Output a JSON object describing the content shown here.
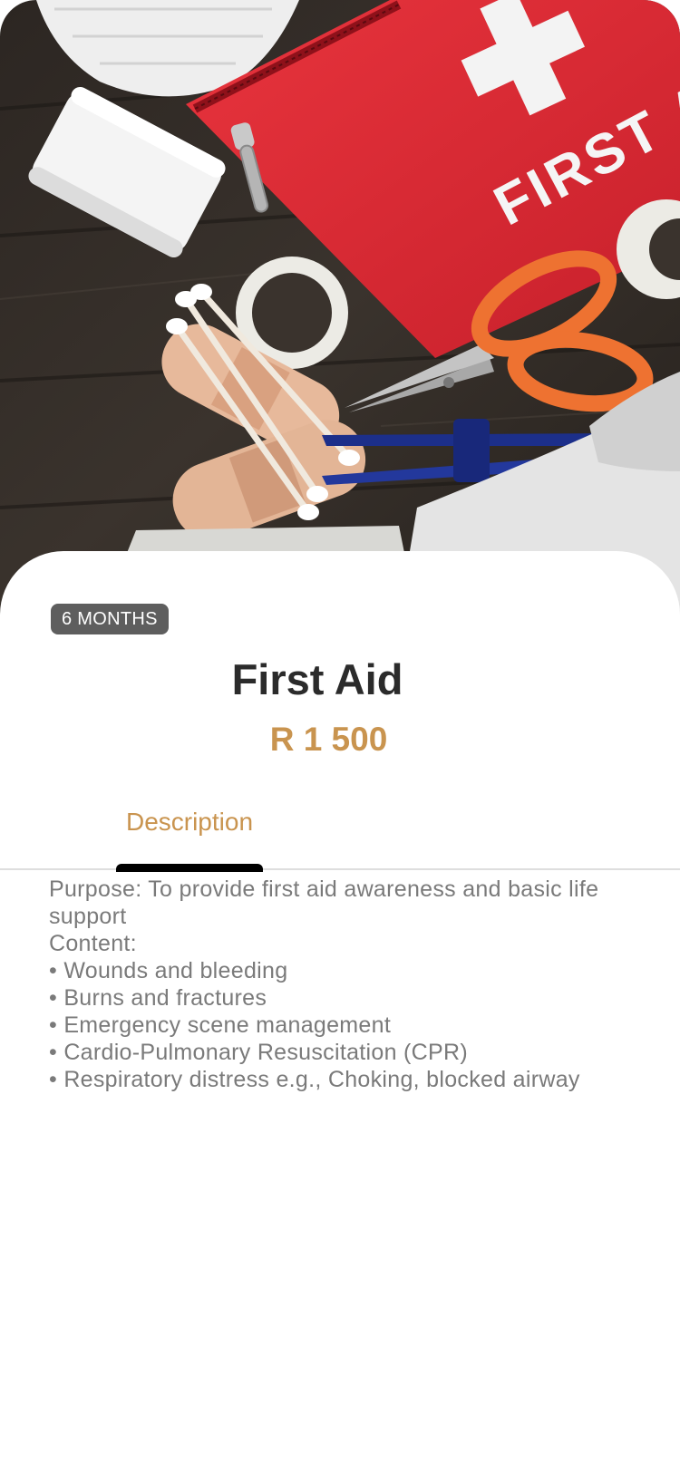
{
  "hero": {
    "image": "first-aid-kit-photo",
    "kit_text": "FIRST AID"
  },
  "course": {
    "duration_badge": "6 MONTHS",
    "title": "First Aid",
    "price": "R 1 500"
  },
  "tabs": [
    {
      "label": "Description",
      "active": true
    }
  ],
  "description": {
    "purpose": "Purpose: To provide first aid awareness and basic life support",
    "content_heading": "Content:",
    "items": [
      "Wounds and bleeding",
      "Burns and fractures",
      "Emergency scene management",
      "Cardio-Pulmonary Resuscitation (CPR)",
      "Respiratory distress e.g., Choking, blocked airway"
    ]
  },
  "colors": {
    "accent": "#c9944f",
    "title": "#2b2b2b",
    "badge_bg": "#5e5e5e",
    "body_text": "#7a7a7a"
  }
}
